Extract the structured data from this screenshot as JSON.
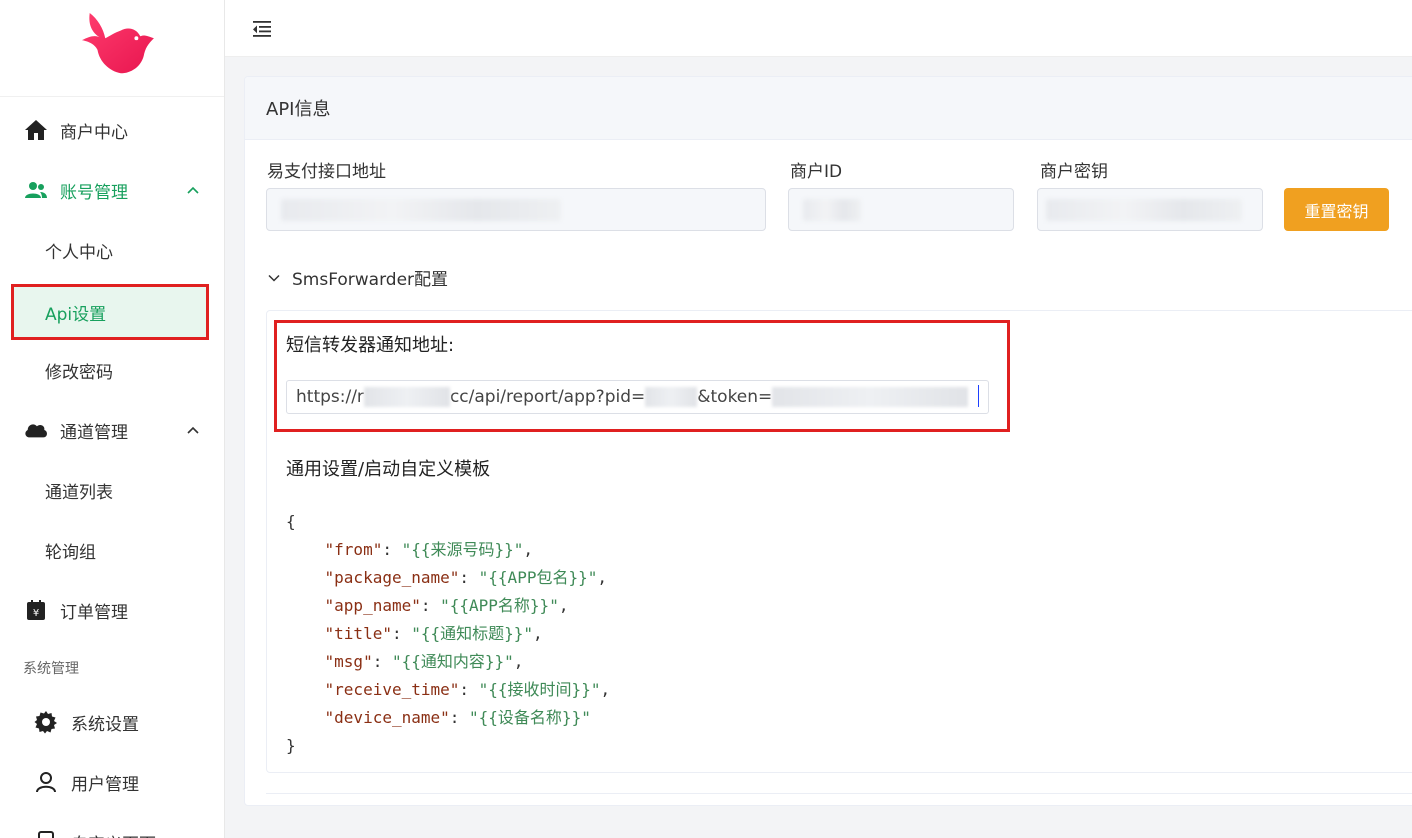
{
  "sidebar": {
    "items": [
      {
        "label": "商户中心",
        "icon": "home-icon"
      },
      {
        "label": "账号管理",
        "icon": "users-icon",
        "expanded": true
      },
      {
        "label": "个人中心"
      },
      {
        "label": "Api设置",
        "active": true
      },
      {
        "label": "修改密码"
      },
      {
        "label": "通道管理",
        "icon": "cloud-icon",
        "expanded": true
      },
      {
        "label": "通道列表"
      },
      {
        "label": "轮询组"
      },
      {
        "label": "订单管理",
        "icon": "order-icon"
      }
    ],
    "group_title": "系统管理",
    "sys_items": [
      {
        "label": "系统设置",
        "icon": "gear-icon"
      },
      {
        "label": "用户管理",
        "icon": "user-icon"
      },
      {
        "label": "自定义页面",
        "icon": "page-icon"
      }
    ]
  },
  "card": {
    "title": "API信息",
    "api_url_label": "易支付接口地址",
    "merchant_id_label": "商户ID",
    "merchant_key_label": "商户密钥",
    "reset_button": "重置密钥",
    "collapse_title": "SmsForwarder配置",
    "notify_label": "短信转发器通知地址:",
    "url_parts": {
      "prefix": "https://r",
      "mid": "cc/api/report/app?pid=",
      "token": "&token="
    },
    "template_title": "通用设置/启动自定义模板",
    "template_json": [
      {
        "key": "\"from\"",
        "value": "\"{{来源号码}}\""
      },
      {
        "key": "\"package_name\"",
        "value": "\"{{APP包名}}\""
      },
      {
        "key": "\"app_name\"",
        "value": "\"{{APP名称}}\""
      },
      {
        "key": "\"title\"",
        "value": "\"{{通知标题}}\""
      },
      {
        "key": "\"msg\"",
        "value": "\"{{通知内容}}\""
      },
      {
        "key": "\"receive_time\"",
        "value": "\"{{接收时间}}\""
      },
      {
        "key": "\"device_name\"",
        "value": "\"{{设备名称}}\""
      }
    ]
  },
  "colors": {
    "accent": "#17a05d",
    "warning": "#f0a020",
    "highlight": "#e02020"
  }
}
